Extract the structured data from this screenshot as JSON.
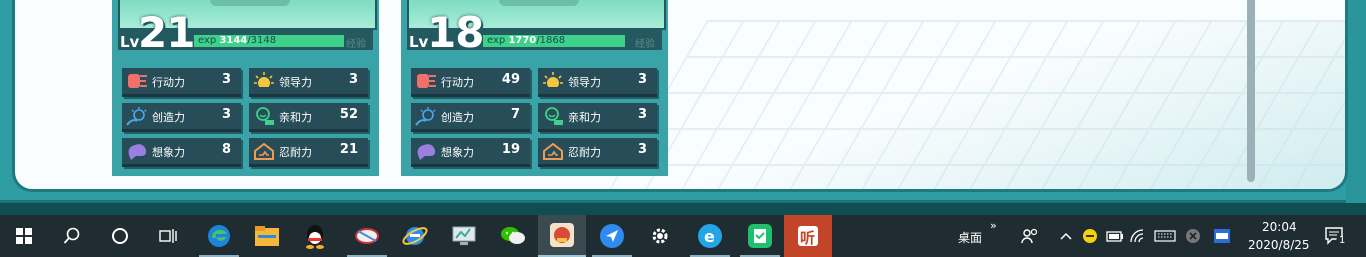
{
  "cards": [
    {
      "level": "21",
      "lv_label": "Lv",
      "exp_label": "exp",
      "exp_current": "3144",
      "exp_max": "/3148",
      "exp_fraction": 0.999,
      "exp_tag": "经验",
      "stats": [
        {
          "name": "行动力",
          "value": "3",
          "icon": "action-icon",
          "color": "#f0706a"
        },
        {
          "name": "领导力",
          "value": "3",
          "icon": "leadership-icon",
          "color": "#f5c542"
        },
        {
          "name": "创造力",
          "value": "3",
          "icon": "creativity-icon",
          "color": "#4aa8f0"
        },
        {
          "name": "亲和力",
          "value": "52",
          "icon": "affinity-icon",
          "color": "#3fd08a"
        },
        {
          "name": "想象力",
          "value": "8",
          "icon": "imagination-icon",
          "color": "#9b7fe0"
        },
        {
          "name": "忍耐力",
          "value": "21",
          "icon": "endurance-icon",
          "color": "#f09a55"
        }
      ]
    },
    {
      "level": "18",
      "lv_label": "Lv",
      "exp_label": "exp",
      "exp_current": "1770",
      "exp_max": "/1868",
      "exp_fraction": 0.95,
      "exp_tag": "经验",
      "stats": [
        {
          "name": "行动力",
          "value": "49",
          "icon": "action-icon",
          "color": "#f0706a"
        },
        {
          "name": "领导力",
          "value": "3",
          "icon": "leadership-icon",
          "color": "#f5c542"
        },
        {
          "name": "创造力",
          "value": "7",
          "icon": "creativity-icon",
          "color": "#4aa8f0"
        },
        {
          "name": "亲和力",
          "value": "3",
          "icon": "affinity-icon",
          "color": "#3fd08a"
        },
        {
          "name": "想象力",
          "value": "19",
          "icon": "imagination-icon",
          "color": "#9b7fe0"
        },
        {
          "name": "忍耐力",
          "value": "3",
          "icon": "endurance-icon",
          "color": "#f09a55"
        }
      ]
    }
  ],
  "taskbar": {
    "icons": [
      "windows-start-icon",
      "search-icon",
      "cortana-icon",
      "task-view-icon",
      "edge-icon",
      "file-explorer-icon",
      "qq-icon",
      "app-icon",
      "ie-icon",
      "remote-desktop-icon",
      "wechat-icon",
      "game-icon",
      "feishu-icon",
      "settings-icon",
      "browser-e-icon",
      "green-app-icon",
      "ting-icon"
    ],
    "desktop_label": "桌面",
    "more_label": "»",
    "time": "20:04",
    "date": "2020/8/25",
    "notification_count": "1"
  }
}
